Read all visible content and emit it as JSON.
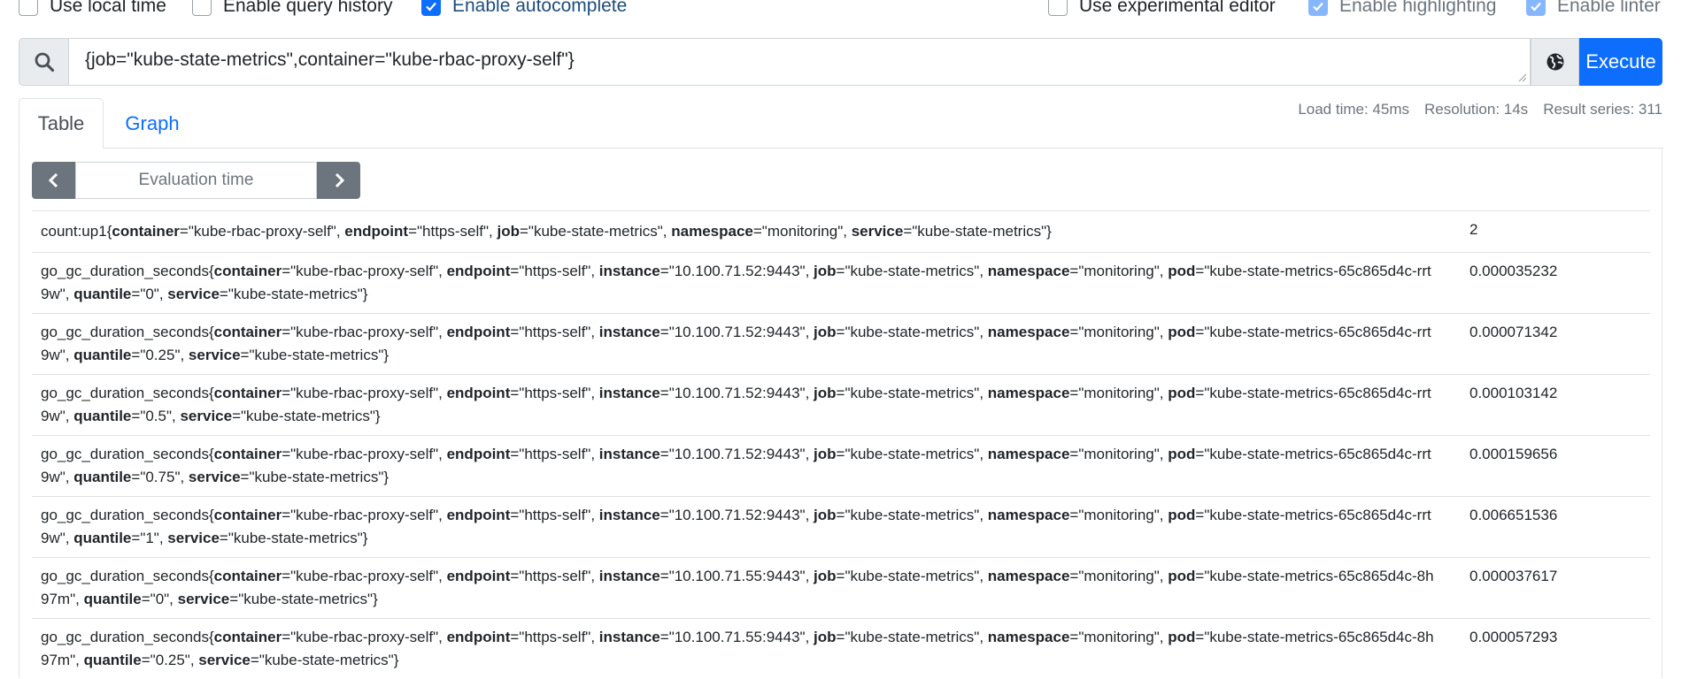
{
  "options": {
    "use_local_time": {
      "label": "Use local time",
      "checked": false
    },
    "enable_query_history": {
      "label": "Enable query history",
      "checked": false
    },
    "enable_autocomplete": {
      "label": "Enable autocomplete",
      "checked": true
    },
    "use_experimental_editor": {
      "label": "Use experimental editor",
      "checked": false
    },
    "enable_highlighting": {
      "label": "Enable highlighting",
      "checked": true
    },
    "enable_linter": {
      "label": "Enable linter",
      "checked": true
    }
  },
  "query": {
    "value": "{job=\"kube-state-metrics\",container=\"kube-rbac-proxy-self\"}",
    "execute_label": "Execute"
  },
  "tabs": {
    "table": "Table",
    "graph": "Graph"
  },
  "stats": {
    "load_time": "Load time: 45ms",
    "resolution": "Resolution: 14s",
    "result_series": "Result series: 311"
  },
  "eval_time": {
    "placeholder": "Evaluation time"
  },
  "results": [
    {
      "metric": "count:up1",
      "labels": [
        [
          "container",
          "kube-rbac-proxy-self"
        ],
        [
          "endpoint",
          "https-self"
        ],
        [
          "job",
          "kube-state-metrics"
        ],
        [
          "namespace",
          "monitoring"
        ],
        [
          "service",
          "kube-state-metrics"
        ]
      ],
      "value": "2"
    },
    {
      "metric": "go_gc_duration_seconds",
      "labels": [
        [
          "container",
          "kube-rbac-proxy-self"
        ],
        [
          "endpoint",
          "https-self"
        ],
        [
          "instance",
          "10.100.71.52:9443"
        ],
        [
          "job",
          "kube-state-metrics"
        ],
        [
          "namespace",
          "monitoring"
        ],
        [
          "pod",
          "kube-state-metrics-65c865d4c-rrt9w"
        ],
        [
          "quantile",
          "0"
        ],
        [
          "service",
          "kube-state-metrics"
        ]
      ],
      "value": "0.000035232"
    },
    {
      "metric": "go_gc_duration_seconds",
      "labels": [
        [
          "container",
          "kube-rbac-proxy-self"
        ],
        [
          "endpoint",
          "https-self"
        ],
        [
          "instance",
          "10.100.71.52:9443"
        ],
        [
          "job",
          "kube-state-metrics"
        ],
        [
          "namespace",
          "monitoring"
        ],
        [
          "pod",
          "kube-state-metrics-65c865d4c-rrt9w"
        ],
        [
          "quantile",
          "0.25"
        ],
        [
          "service",
          "kube-state-metrics"
        ]
      ],
      "value": "0.000071342"
    },
    {
      "metric": "go_gc_duration_seconds",
      "labels": [
        [
          "container",
          "kube-rbac-proxy-self"
        ],
        [
          "endpoint",
          "https-self"
        ],
        [
          "instance",
          "10.100.71.52:9443"
        ],
        [
          "job",
          "kube-state-metrics"
        ],
        [
          "namespace",
          "monitoring"
        ],
        [
          "pod",
          "kube-state-metrics-65c865d4c-rrt9w"
        ],
        [
          "quantile",
          "0.5"
        ],
        [
          "service",
          "kube-state-metrics"
        ]
      ],
      "value": "0.000103142"
    },
    {
      "metric": "go_gc_duration_seconds",
      "labels": [
        [
          "container",
          "kube-rbac-proxy-self"
        ],
        [
          "endpoint",
          "https-self"
        ],
        [
          "instance",
          "10.100.71.52:9443"
        ],
        [
          "job",
          "kube-state-metrics"
        ],
        [
          "namespace",
          "monitoring"
        ],
        [
          "pod",
          "kube-state-metrics-65c865d4c-rrt9w"
        ],
        [
          "quantile",
          "0.75"
        ],
        [
          "service",
          "kube-state-metrics"
        ]
      ],
      "value": "0.000159656"
    },
    {
      "metric": "go_gc_duration_seconds",
      "labels": [
        [
          "container",
          "kube-rbac-proxy-self"
        ],
        [
          "endpoint",
          "https-self"
        ],
        [
          "instance",
          "10.100.71.52:9443"
        ],
        [
          "job",
          "kube-state-metrics"
        ],
        [
          "namespace",
          "monitoring"
        ],
        [
          "pod",
          "kube-state-metrics-65c865d4c-rrt9w"
        ],
        [
          "quantile",
          "1"
        ],
        [
          "service",
          "kube-state-metrics"
        ]
      ],
      "value": "0.006651536"
    },
    {
      "metric": "go_gc_duration_seconds",
      "labels": [
        [
          "container",
          "kube-rbac-proxy-self"
        ],
        [
          "endpoint",
          "https-self"
        ],
        [
          "instance",
          "10.100.71.55:9443"
        ],
        [
          "job",
          "kube-state-metrics"
        ],
        [
          "namespace",
          "monitoring"
        ],
        [
          "pod",
          "kube-state-metrics-65c865d4c-8h97m"
        ],
        [
          "quantile",
          "0"
        ],
        [
          "service",
          "kube-state-metrics"
        ]
      ],
      "value": "0.000037617"
    },
    {
      "metric": "go_gc_duration_seconds",
      "labels": [
        [
          "container",
          "kube-rbac-proxy-self"
        ],
        [
          "endpoint",
          "https-self"
        ],
        [
          "instance",
          "10.100.71.55:9443"
        ],
        [
          "job",
          "kube-state-metrics"
        ],
        [
          "namespace",
          "monitoring"
        ],
        [
          "pod",
          "kube-state-metrics-65c865d4c-8h97m"
        ],
        [
          "quantile",
          "0.25"
        ],
        [
          "service",
          "kube-state-metrics"
        ]
      ],
      "value": "0.000057293"
    }
  ],
  "icons": {
    "search": "search-icon",
    "globe": "globe-icon",
    "prev": "chevron-left-icon",
    "next": "chevron-right-icon"
  },
  "colors": {
    "primary": "#0d6efd",
    "secondary": "#6c757d",
    "border": "#dee2e6"
  }
}
